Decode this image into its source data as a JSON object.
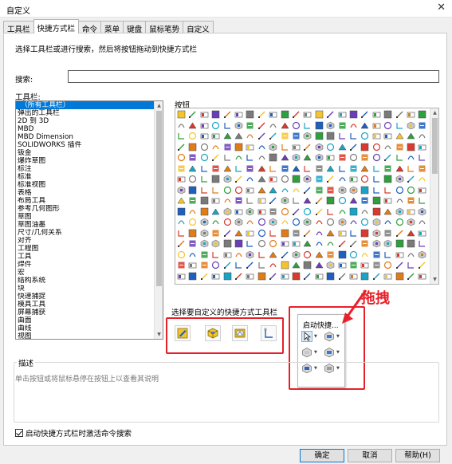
{
  "window": {
    "title": "自定义",
    "close_glyph": "✕"
  },
  "tabs": [
    {
      "label": "工具栏"
    },
    {
      "label": "快捷方式栏",
      "active": true
    },
    {
      "label": "命令"
    },
    {
      "label": "菜单"
    },
    {
      "label": "键盘"
    },
    {
      "label": "鼠标笔势"
    },
    {
      "label": "自定义"
    }
  ],
  "instructions": "选择工具栏或进行搜索，然后将按钮拖动到快捷方式栏",
  "search": {
    "label": "搜索:",
    "value": ""
  },
  "toolbars": {
    "label": "工具栏:",
    "items": [
      "（所有工具栏）",
      "弹出的工具栏",
      "2D 到 3D",
      "MBD",
      "MBD Dimension",
      "SOLIDWORKS 插件",
      "钣金",
      "爆炸草图",
      "标注",
      "标准",
      "标准视图",
      "表格",
      "布局工具",
      "参考几何图形",
      "草图",
      "草图油墨",
      "尺寸/几何关系",
      "对齐",
      "工程图",
      "工具",
      "焊件",
      "宏",
      "结构系统",
      "块",
      "快速捕捉",
      "模具工具",
      "屏幕捕获",
      "曲面",
      "曲线",
      "视图"
    ],
    "selected_index": 0
  },
  "buttons_panel": {
    "label": "按钮"
  },
  "shortcut_bar": {
    "label": "选择要自定义的快捷方式工具栏",
    "items": [
      {
        "icon": "sketch-pencil-icon"
      },
      {
        "icon": "part-cube-icon"
      },
      {
        "icon": "drawing-sheet-icon"
      },
      {
        "icon": "sketch-line-icon"
      }
    ]
  },
  "popup": {
    "title": "启动快捷...",
    "buttons": [
      {
        "icon": "cursor-arrow-icon"
      },
      {
        "icon": "view-orientation-icon"
      },
      {
        "icon": "display-style-icon"
      },
      {
        "icon": "section-view-icon"
      },
      {
        "icon": "hide-show-icon"
      },
      {
        "icon": "appearance-icon"
      }
    ]
  },
  "annotation": {
    "drag_text": "拖拽"
  },
  "description": {
    "label": "描述",
    "hint": "单击按钮或将鼠标悬停在按钮上以查看其说明"
  },
  "activate_search": {
    "label": "启动快捷方式栏时激活命令搜索",
    "checked": true
  },
  "dialog_buttons": {
    "ok": "确定",
    "cancel": "取消",
    "help": "帮助(H)"
  },
  "colors": {
    "accent": "#0078d7",
    "annotation_red": "#e8202a"
  }
}
